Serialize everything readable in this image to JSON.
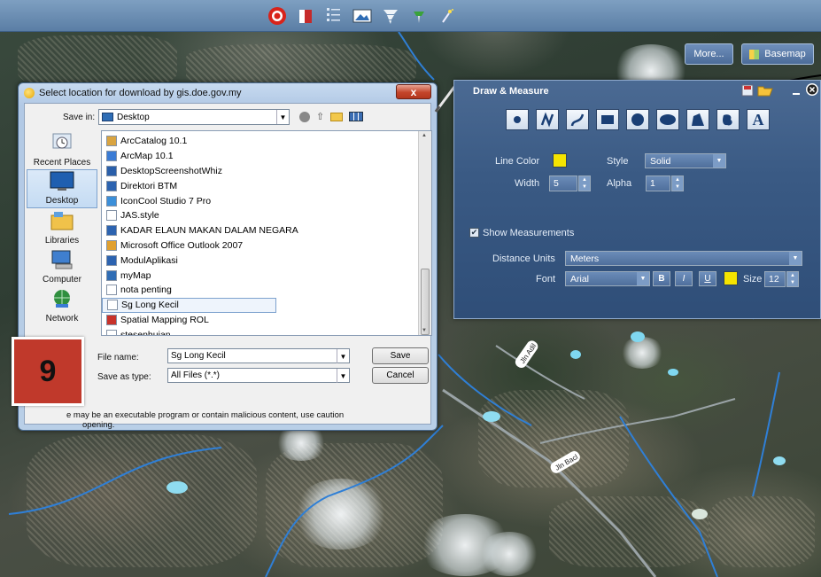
{
  "toolbar": {
    "icons": [
      "target-icon",
      "bookmark-icon",
      "list-icon",
      "image-icon",
      "tornado-icon",
      "tools-icon",
      "magic-icon"
    ]
  },
  "map_buttons": {
    "more": "More...",
    "basemap": "Basemap"
  },
  "dialog": {
    "title": "Select location for download by gis.doe.gov.my",
    "close": "x",
    "save_in_label": "Save in:",
    "save_in_value": "Desktop",
    "places": [
      {
        "label": "Recent Places",
        "icon": "recent-places-icon"
      },
      {
        "label": "Desktop",
        "icon": "desktop-icon"
      },
      {
        "label": "Libraries",
        "icon": "libraries-icon"
      },
      {
        "label": "Computer",
        "icon": "computer-icon"
      },
      {
        "label": "Network",
        "icon": "network-icon"
      }
    ],
    "files": [
      {
        "name": "ArcCatalog 10.1",
        "icon": "arccatalog-icon"
      },
      {
        "name": "ArcMap 10.1",
        "icon": "arcmap-icon"
      },
      {
        "name": "DesktopScreenshotWhiz",
        "icon": "screenshot-app-icon"
      },
      {
        "name": "Direktori BTM",
        "icon": "document-icon"
      },
      {
        "name": "IconCool Studio 7 Pro",
        "icon": "iconcool-icon"
      },
      {
        "name": "JAS.style",
        "icon": "file-icon"
      },
      {
        "name": "KADAR ELAUN MAKAN DALAM NEGARA",
        "icon": "document-icon"
      },
      {
        "name": "Microsoft Office Outlook 2007",
        "icon": "outlook-icon"
      },
      {
        "name": "ModulAplikasi",
        "icon": "document-icon"
      },
      {
        "name": "myMap",
        "icon": "map-document-icon"
      },
      {
        "name": "nota penting",
        "icon": "file-icon"
      },
      {
        "name": "Sg Long Kecil",
        "icon": "file-icon"
      },
      {
        "name": "Spatial Mapping ROL",
        "icon": "pdf-icon"
      },
      {
        "name": "stesenhujan",
        "icon": "file-icon"
      }
    ],
    "file_name_label": "File name:",
    "file_name_value": "Sg Long Kecil",
    "save_as_label": "Save as type:",
    "save_as_value": "All Files (*.*)",
    "save_button": "Save",
    "cancel_button": "Cancel",
    "warning": "e may be an executable program or contain malicious content, use caution",
    "warning2": "opening."
  },
  "badge": {
    "text": "9"
  },
  "panel": {
    "title": "Draw & Measure",
    "tools": [
      "point-icon",
      "polyline-icon",
      "freehand-icon",
      "rectangle-icon",
      "circle-icon",
      "ellipse-icon",
      "polygon-icon",
      "freehand-polygon-icon",
      "text-icon"
    ],
    "text_tool_glyph": "A",
    "line_color_label": "Line Color",
    "line_color": "#f5e400",
    "style_label": "Style",
    "style_value": "Solid",
    "width_label": "Width",
    "width_value": "5",
    "alpha_label": "Alpha",
    "alpha_value": "1",
    "show_measurements_label": "Show Measurements",
    "show_measurements_checked": true,
    "distance_units_label": "Distance Units",
    "distance_units_value": "Meters",
    "font_label": "Font",
    "font_value": "Arial",
    "bold": "B",
    "italic": "I",
    "underline": "U",
    "font_color": "#f5e400",
    "size_label": "Size",
    "size_value": "12"
  },
  "map_labels": {
    "road_a": "Jln Adil",
    "road_b": "Jln Bacl"
  }
}
